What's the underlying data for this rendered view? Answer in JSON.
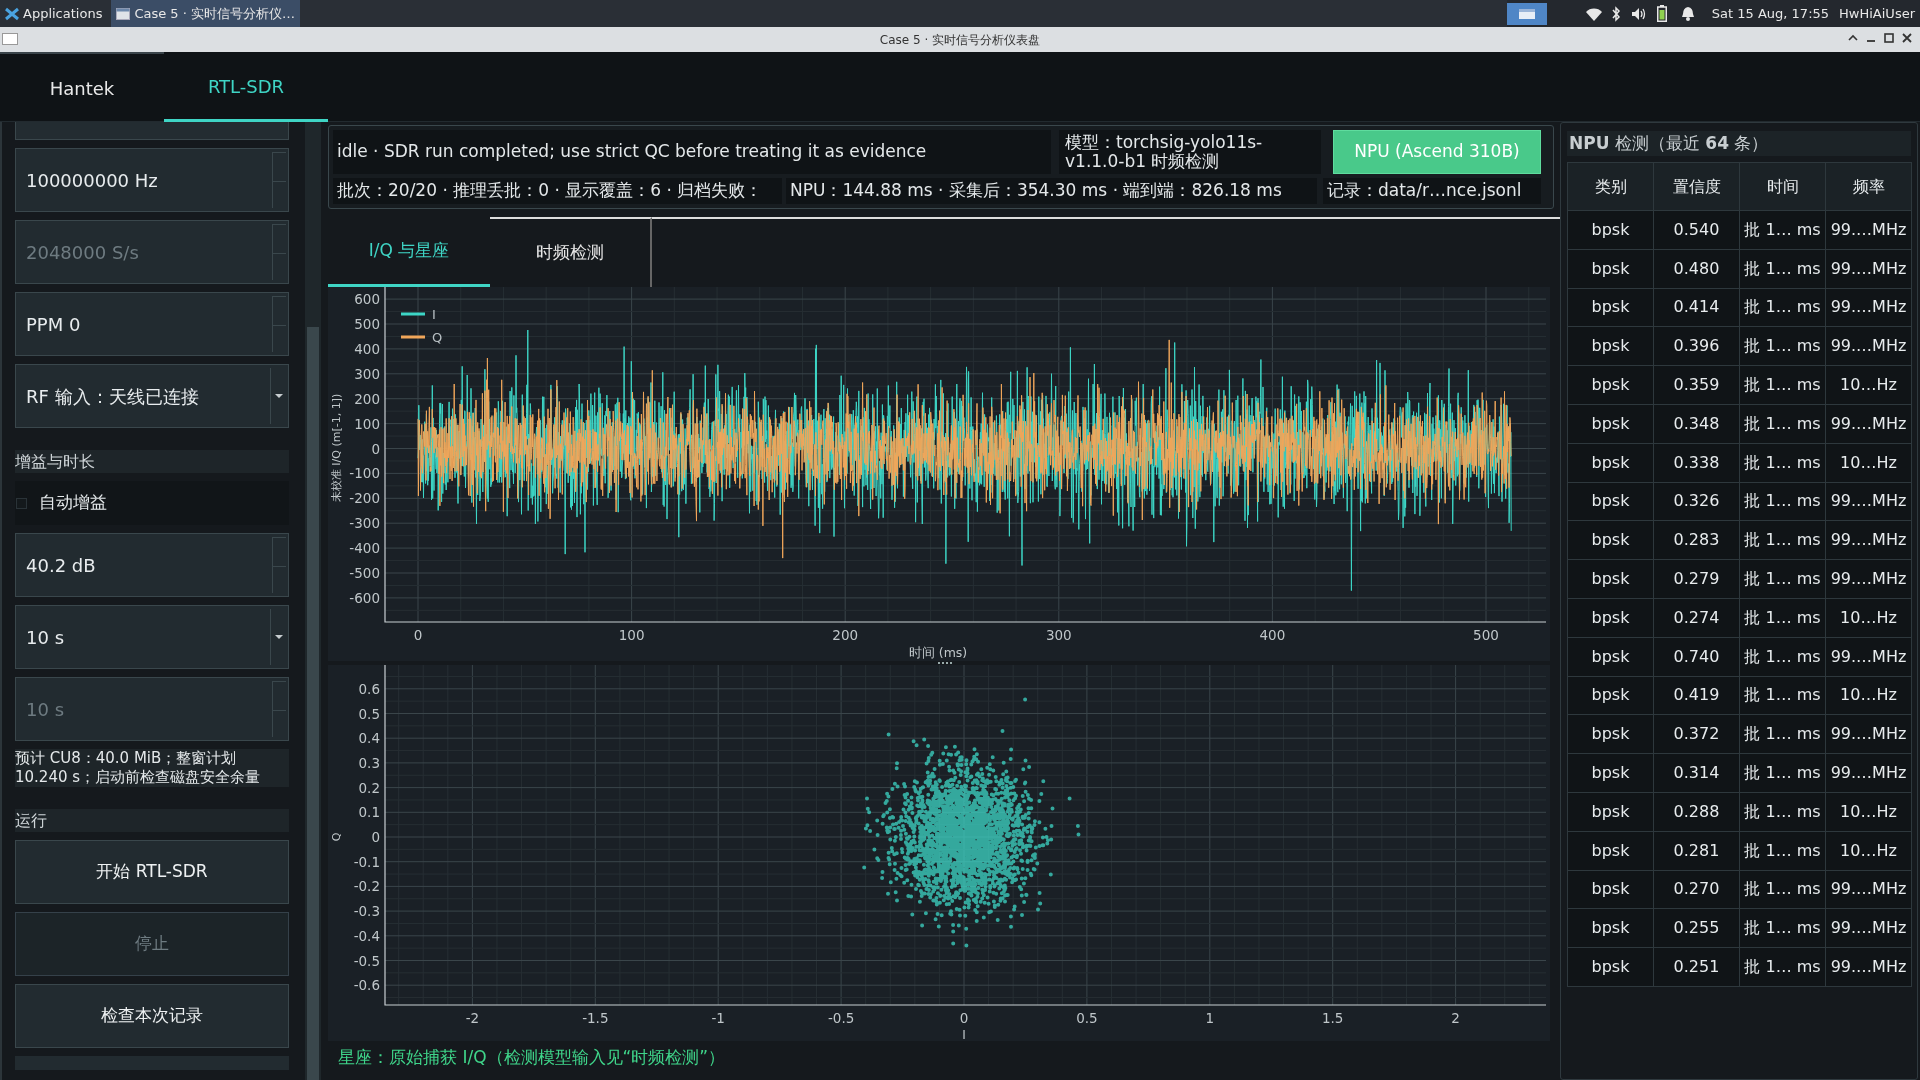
{
  "taskbar": {
    "apps_menu": "Applications",
    "window_button": "Case 5 · 实时信号分析仪…",
    "clock": "Sat 15 Aug, 17:55",
    "user": "HwHiAiUser"
  },
  "window": {
    "title": "Case 5 · 实时信号分析仪表盘"
  },
  "tabs": [
    {
      "label": "Hantek",
      "selected": false
    },
    {
      "label": "RTL-SDR",
      "selected": true
    }
  ],
  "sidebar": {
    "items": [
      {
        "kind": "spinbox",
        "value": "100000000 Hz",
        "disabled": false
      },
      {
        "kind": "spinbox",
        "value": "2048000 S/s",
        "disabled": true
      },
      {
        "kind": "spinbox",
        "value": "PPM 0",
        "disabled": false
      },
      {
        "kind": "combo",
        "value": "RF 输入：天线已连接",
        "disabled": false
      },
      {
        "kind": "section",
        "label": "增益与时长"
      },
      {
        "kind": "checkbox",
        "label": "自动增益",
        "checked": false
      },
      {
        "kind": "spinbox",
        "value": "40.2 dB",
        "disabled": false
      },
      {
        "kind": "combo",
        "value": "10 s",
        "disabled": false
      },
      {
        "kind": "spinbox",
        "value": "10 s",
        "disabled": true
      },
      {
        "kind": "note",
        "text": "预计 CU8：40.0 MiB；整窗计划 10.240 s；启动前检查磁盘安全余量"
      },
      {
        "kind": "section",
        "label": "运行"
      },
      {
        "kind": "button",
        "label": "开始 RTL-SDR",
        "disabled": false
      },
      {
        "kind": "button",
        "label": "停止",
        "disabled": true
      },
      {
        "kind": "button",
        "label": "检查本次记录",
        "disabled": false
      }
    ]
  },
  "status": {
    "message": "idle · SDR run completed; use strict QC before treating it as evidence",
    "model": "模型：torchsig-yolo11s-v1.1.0-b1 时频检测",
    "npu_button": "NPU (Ascend 310B)",
    "counters": "批次：20/20 · 推理丢批：0 · 显示覆盖：6 · 归档失败：",
    "timings": "NPU：144.88 ms · 采集后：354.30 ms · 端到端：826.18 ms",
    "record": "记录：data/r…nce.jsonl"
  },
  "view_tabs": [
    {
      "label": "I/Q 与星座",
      "selected": true
    },
    {
      "label": "时频检测",
      "selected": false
    }
  ],
  "waveform_plot": {
    "ylabel": "未校准 I/Q (m[-1, 1])",
    "xlabel": "时间 (ms)",
    "yticks": [
      "600",
      "500",
      "400",
      "300",
      "200",
      "100",
      "0",
      "-100",
      "-200",
      "-300",
      "-400",
      "-500",
      "-600"
    ],
    "xticks": [
      "0",
      "100",
      "200",
      "300",
      "400",
      "500"
    ],
    "legend": [
      {
        "name": "I",
        "color": "#3dd6c6"
      },
      {
        "name": "Q",
        "color": "#f0a65a"
      }
    ]
  },
  "constellation_plot": {
    "ylabel": "Q",
    "xlabel": "I",
    "yticks": [
      "0.6",
      "0.5",
      "0.4",
      "0.3",
      "0.2",
      "0.1",
      "0",
      "-0.1",
      "-0.2",
      "-0.3",
      "-0.4",
      "-0.5",
      "-0.6"
    ],
    "xticks": [
      "-2",
      "-1.5",
      "-1",
      "-0.5",
      "0",
      "0.5",
      "1",
      "1.5",
      "2"
    ]
  },
  "caption": "星座：原始捕获 I/Q（检测模型输入见“时频检测”）",
  "detections": {
    "title": "**NPU** 检测（最近 **64** 条）",
    "columns": [
      "类别",
      "置信度",
      "时间",
      "频率"
    ],
    "rows": [
      [
        "bpsk",
        "0.540",
        "批 1… ms",
        "99.…MHz"
      ],
      [
        "bpsk",
        "0.480",
        "批 1… ms",
        "99.…MHz"
      ],
      [
        "bpsk",
        "0.414",
        "批 1… ms",
        "99.…MHz"
      ],
      [
        "bpsk",
        "0.396",
        "批 1… ms",
        "99.…MHz"
      ],
      [
        "bpsk",
        "0.359",
        "批 1… ms",
        "10…Hz"
      ],
      [
        "bpsk",
        "0.348",
        "批 1… ms",
        "99.…MHz"
      ],
      [
        "bpsk",
        "0.338",
        "批 1… ms",
        "10…Hz"
      ],
      [
        "bpsk",
        "0.326",
        "批 1… ms",
        "99.…MHz"
      ],
      [
        "bpsk",
        "0.283",
        "批 1… ms",
        "99.…MHz"
      ],
      [
        "bpsk",
        "0.279",
        "批 1… ms",
        "99.…MHz"
      ],
      [
        "bpsk",
        "0.274",
        "批 1… ms",
        "10…Hz"
      ],
      [
        "bpsk",
        "0.740",
        "批 1… ms",
        "99.…MHz"
      ],
      [
        "bpsk",
        "0.419",
        "批 1… ms",
        "10…Hz"
      ],
      [
        "bpsk",
        "0.372",
        "批 1… ms",
        "99.…MHz"
      ],
      [
        "bpsk",
        "0.314",
        "批 1… ms",
        "99.…MHz"
      ],
      [
        "bpsk",
        "0.288",
        "批 1… ms",
        "10…Hz"
      ],
      [
        "bpsk",
        "0.281",
        "批 1… ms",
        "10…Hz"
      ],
      [
        "bpsk",
        "0.270",
        "批 1… ms",
        "99.…MHz"
      ],
      [
        "bpsk",
        "0.255",
        "批 1… ms",
        "99.…MHz"
      ],
      [
        "bpsk",
        "0.251",
        "批 1… ms",
        "99.…MHz"
      ]
    ]
  }
}
